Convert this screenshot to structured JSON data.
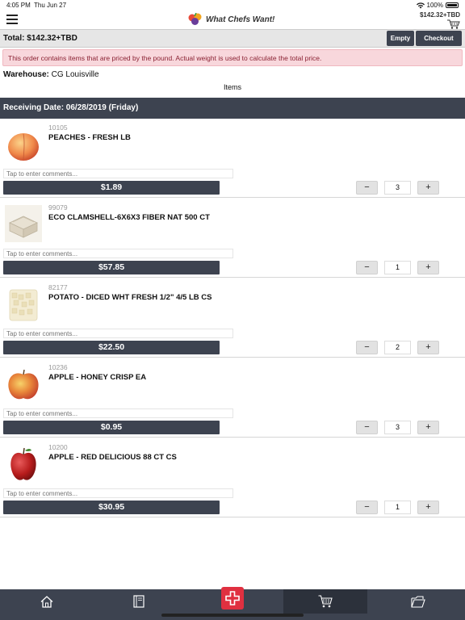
{
  "status": {
    "time": "4:05 PM",
    "date": "Thu Jun 27",
    "battery": "100%"
  },
  "header": {
    "brand": "What Chefs Want!",
    "cart_total": "$142.32+TBD"
  },
  "totals": {
    "total_text": "Total:  $142.32+TBD",
    "empty_label": "Empty",
    "checkout_label": "Checkout"
  },
  "notice": "This order contains items that are priced by the pound. Actual weight is used to calculate the total price.",
  "warehouse": {
    "label": "Warehouse:",
    "value": "CG Louisville"
  },
  "items_label": "Items",
  "receiving_date": "Receiving Date: 06/28/2019 (Friday)",
  "comment_placeholder": "Tap to enter comments...",
  "items": [
    {
      "code": "10105",
      "name": "PEACHES - FRESH LB",
      "price": "$1.89",
      "qty": "3",
      "icon": "peach-image"
    },
    {
      "code": "99079",
      "name": "ECO CLAMSHELL-6X6X3 FIBER NAT 500 CT",
      "price": "$57.85",
      "qty": "1",
      "icon": "clamshell-image"
    },
    {
      "code": "82177",
      "name": "POTATO - DICED WHT FRESH 1/2\" 4/5 LB CS",
      "price": "$22.50",
      "qty": "2",
      "icon": "potato-image"
    },
    {
      "code": "10236",
      "name": "APPLE - HONEY CRISP EA",
      "price": "$0.95",
      "qty": "3",
      "icon": "apple-image"
    },
    {
      "code": "10200",
      "name": "APPLE - RED DELICIOUS 88 CT CS",
      "price": "$30.95",
      "qty": "1",
      "icon": "red-apple-image"
    }
  ],
  "controls": {
    "minus": "−",
    "plus": "+"
  },
  "colors": {
    "dark": "#3d4350",
    "accent": "#e03040",
    "notice_bg": "#f8d7dc"
  }
}
